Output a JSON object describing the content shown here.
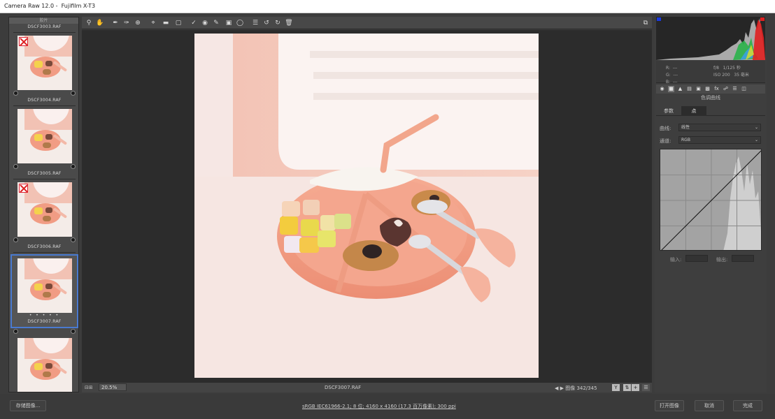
{
  "window": {
    "title": "Camera Raw 12.0 -  Fujifilm X-T3"
  },
  "filmstrip": {
    "header": "胶片",
    "items": [
      {
        "name_above": "DSCF3003.RAF",
        "rejected": true
      },
      {
        "name_above": "DSCF3004.RAF",
        "rejected": false
      },
      {
        "name_above": "DSCF3005.RAF",
        "rejected": true
      },
      {
        "name_above": "DSCF3006.RAF",
        "rejected": false,
        "selected": true,
        "rating": "• • • • •"
      },
      {
        "name_above": "DSCF3007.RAF",
        "rejected": false
      }
    ]
  },
  "toolbar": {
    "tools": [
      "zoom-icon",
      "hand-icon",
      "white-balance-icon",
      "color-sampler-icon",
      "targeted-adjust-icon",
      "crop-icon",
      "straighten-icon",
      "transform-icon",
      "spot-removal-icon",
      "red-eye-icon",
      "adjustment-brush-icon",
      "graduated-filter-icon",
      "radial-filter-icon",
      "preferences-icon",
      "rotate-ccw-icon",
      "rotate-cw-icon",
      "trash-icon"
    ]
  },
  "canvas_bar": {
    "zoom": "20.5%",
    "filename": "DSCF3007.RAF",
    "image_counter": "图像 342/345"
  },
  "info": {
    "rgb": "R:  ---\nG:  ---\nB:  ---",
    "exif": "f/8   1/125 秒\nISO 200   35 毫米"
  },
  "panel": {
    "title": "色调曲线",
    "tab_parametric": "参数",
    "tab_point": "点",
    "curve_label": "曲线:",
    "curve_value": "线性",
    "channel_label": "通道:",
    "channel_value": "RGB",
    "input_label": "输入:",
    "output_label": "输出:"
  },
  "bottom": {
    "save_label": "存储图像...",
    "workflow_link": "sRGB IEC61966-2.1; 8 位; 4160 x 4160 (17.3 百万像素); 300 ppi",
    "open_label": "打开图像",
    "cancel_label": "取消",
    "done_label": "完成"
  }
}
